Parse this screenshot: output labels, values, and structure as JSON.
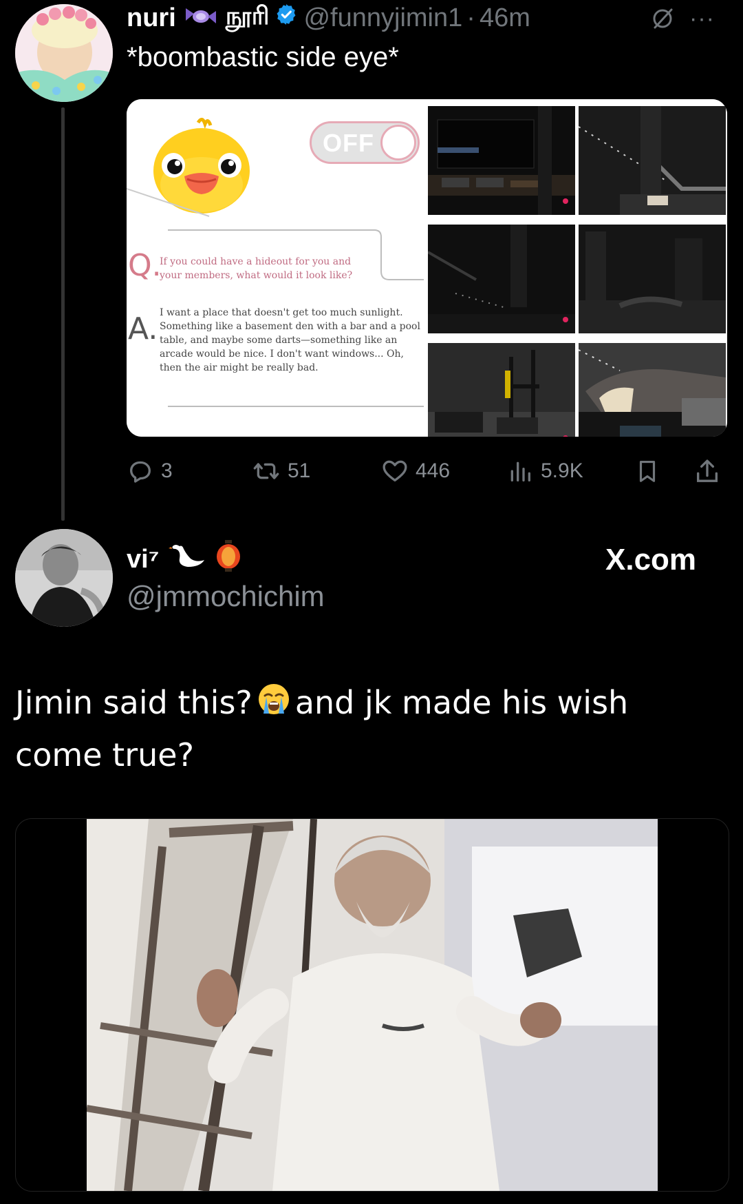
{
  "tweet1": {
    "display_name": "nuri",
    "name_emoji": "ephemeral-candy-emoji",
    "tamil_name": "நூரி",
    "verified": true,
    "handle": "@funnyjimin1",
    "separator": "·",
    "time": "46m",
    "more": "···",
    "text": "*boombastic side eye*",
    "media": {
      "toggle_label": "OFF",
      "question_letter": "Q.",
      "question": "If you could have a hideout for you and your members, what would it look like?",
      "answer_letter": "A.",
      "answer": "I want a place that doesn't get too much sunlight. Something like a basement den with a bar and a pool table, and maybe some darts—something like an arcade would be nice. I don't want windows... Oh, then the air might be really bad."
    },
    "actions": {
      "replies": "3",
      "reposts": "51",
      "likes": "446",
      "views": "5.9K"
    }
  },
  "tweet2": {
    "display_name": "vi⁷",
    "handle": "@jmmochichim",
    "watermark": "X.com",
    "text_part1": "Jimin said this?",
    "text_part2": "and jk made his wish come true?"
  },
  "colors": {
    "background": "#000000",
    "secondary_text": "#71767b",
    "verified_blue": "#1d9bf0",
    "accent_pink": "#d57b8a"
  }
}
